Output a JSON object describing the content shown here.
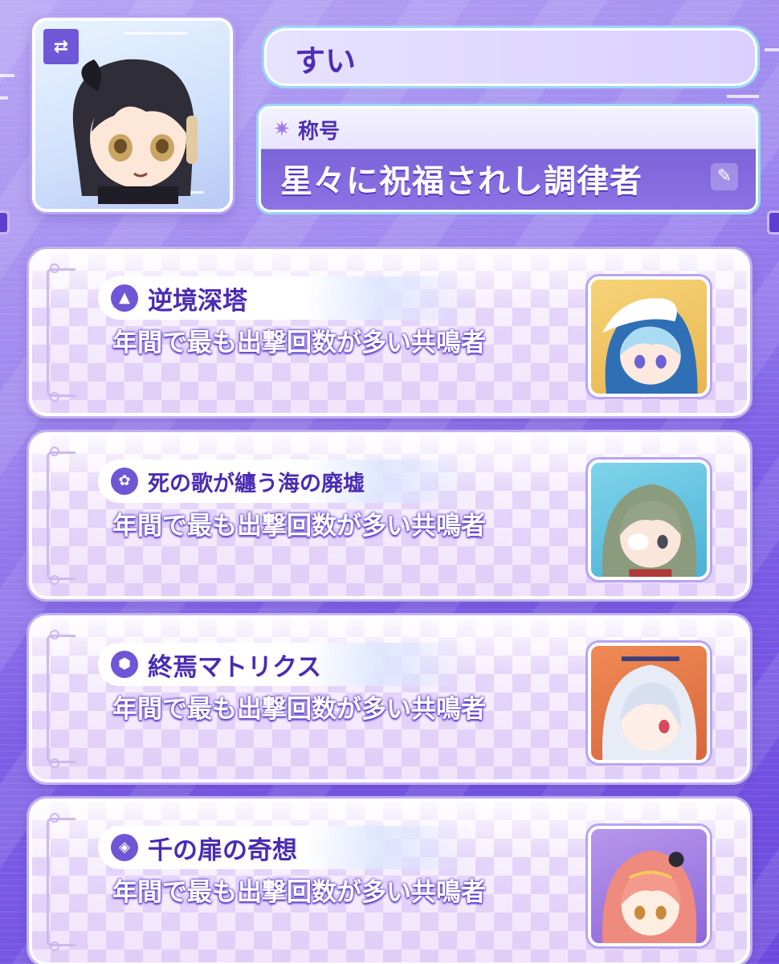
{
  "profile": {
    "name": "すい",
    "title_label": "称号",
    "title": "星々に祝福されし調律者"
  },
  "icons": {
    "swap": "swap-arrows-icon",
    "sparkle": "sparkle-icon",
    "edit": "edit-icon"
  },
  "cards": [
    {
      "mode": "逆境深塔",
      "icon": "triangle-emblem-icon",
      "description": "年間で最も出撃回数が多い共鳴者",
      "portrait": "white-haired-resonator-portrait"
    },
    {
      "mode": "死の歌が纏う海の廃墟",
      "icon": "swirl-emblem-icon",
      "description": "年間で最も出撃回数が多い共鳴者",
      "portrait": "green-haired-resonator-portrait"
    },
    {
      "mode": "終焉マトリクス",
      "icon": "hex-emblem-icon",
      "description": "年間で最も出撃回数が多い共鳴者",
      "portrait": "silver-haired-resonator-portrait"
    },
    {
      "mode": "千の扉の奇想",
      "icon": "diamond-emblem-icon",
      "description": "年間で最も出撃回数が多い共鳴者",
      "portrait": "pink-haired-resonator-portrait"
    }
  ],
  "colors": {
    "accent": "#4d2fb5",
    "background": "#7d5fe6",
    "card": "#f6ecfd"
  }
}
